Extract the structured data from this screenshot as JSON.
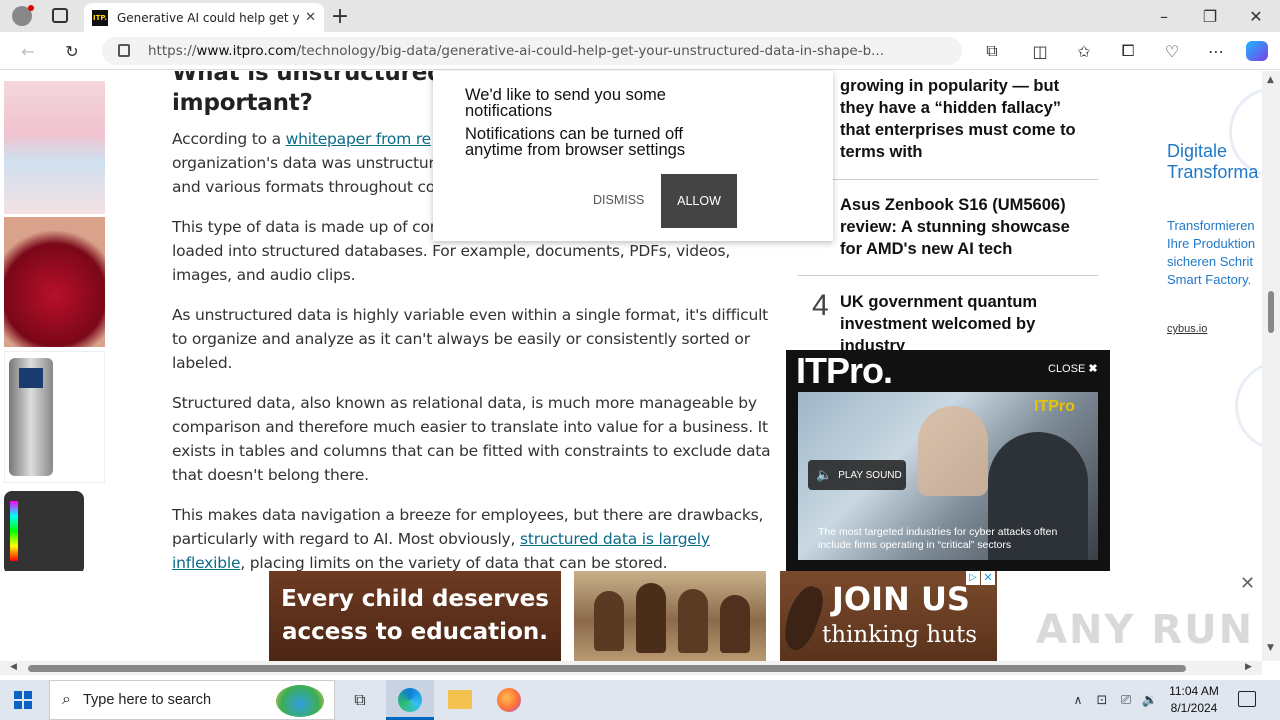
{
  "browser": {
    "tab_title": "Generative AI could help get your unstructured data in shape",
    "tab_favicon": "ITP.",
    "url_prefix": "https://",
    "url_domain": "www.itpro.com",
    "url_path": "/technology/big-data/generative-ai-could-help-get-your-unstructured-data-in-shape-b..."
  },
  "article": {
    "heading_line1": "What is unstructured",
    "heading_line2": "important?",
    "p1_a": "According to a ",
    "p1_link": "whitepaper from re",
    "p1_line2": "organization's data was unstructur",
    "p1_line3": "and various formats throughout co",
    "p2_line1": "This type of data is made up of con",
    "p2_line2": "loaded into structured databases. For example, documents, PDFs, videos,",
    "p2_line3": "images, and audio clips.",
    "p3_line1": "As unstructured data is highly variable even within a single format, it's difficult",
    "p3_line2": "to organize and analyze as it can't always be easily or consistently sorted or",
    "p3_line3": "labeled.",
    "p4_line1": "Structured data, also known as relational data, is much more manageable by",
    "p4_line2": "comparison and therefore much easier to translate into value for a business. It",
    "p4_line3": "exists in tables and columns that can be fitted with constraints to exclude data",
    "p4_line4": "that doesn't belong there.",
    "p5_line1": "This makes data navigation a breeze for employees, but there are drawbacks,",
    "p5_line2a": "particularly with regard to AI. Most obviously, ",
    "p5_link1": "structured data is largely",
    "p5_link2": "inflexible",
    "p5_line3b": ", placing limits on the variety of data that can be stored."
  },
  "notification": {
    "line1": "We'd like to send you some",
    "line2": "notifications",
    "line3": "Notifications can be turned off",
    "line4": "anytime from browser settings",
    "dismiss": "DISMISS",
    "allow": "ALLOW"
  },
  "sidebar": {
    "item1_lines": [
      "growing in popularity — but",
      "they have a “hidden fallacy”",
      "that enterprises must come to",
      "terms with"
    ],
    "item2_lines": [
      "Asus Zenbook S16 (UM5606)",
      "review: A stunning showcase",
      "for AMD's new AI tech"
    ],
    "item4_number": "4",
    "item4_lines": [
      "UK government quantum",
      "investment welcomed by",
      "industry"
    ]
  },
  "right_ad": {
    "title1": "Digitale",
    "title2": "Transforma",
    "body": [
      "Transformieren",
      "Ihre Produktion",
      "sicheren Schrit",
      "Smart Factory."
    ],
    "link": "cybus.io"
  },
  "video": {
    "logo": "ITPro.",
    "close": "CLOSE",
    "play_sound": "PLAY SOUND",
    "watermark": "ITPro",
    "caption1": "The most targeted industries for cyber attacks often",
    "caption2": "include firms operating in “critical” sectors"
  },
  "bottom_ad": {
    "line1": "Every child deserves",
    "line2": "access to education.",
    "join": "JOIN US",
    "thinking": "thinking huts"
  },
  "watermark": "ANY RUN",
  "taskbar": {
    "search_placeholder": "Type here to search",
    "time": "11:04 AM",
    "date": "8/1/2024"
  },
  "colors": {
    "link": "#0b6b8a",
    "allow_bg": "#444444",
    "accent": "#0067c0"
  }
}
